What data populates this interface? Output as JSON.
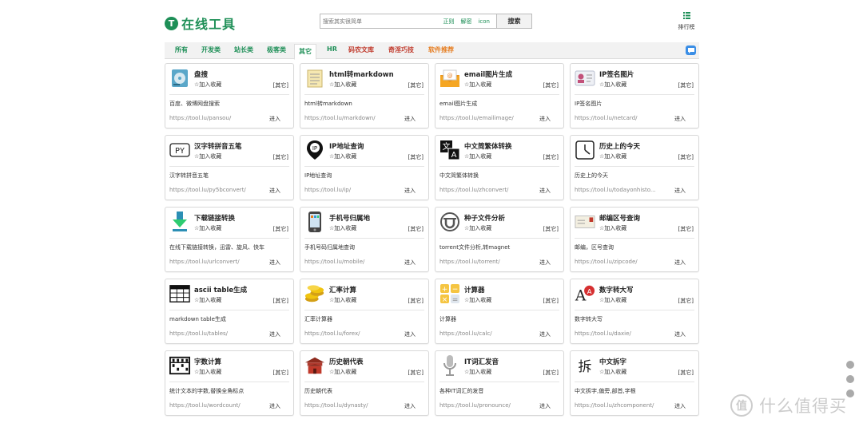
{
  "header": {
    "logo_letter": "T",
    "logo_text": "在线工具",
    "search_placeholder": "搜索其实很简单",
    "search_options": [
      "正则",
      "解密",
      "icon"
    ],
    "search_button": "搜索",
    "rank_label": "排行榜"
  },
  "tabs": [
    {
      "label": "所有",
      "style": "normal"
    },
    {
      "label": "开发类",
      "style": "normal"
    },
    {
      "label": "站长类",
      "style": "normal"
    },
    {
      "label": "极客类",
      "style": "normal"
    },
    {
      "label": "其它",
      "style": "active"
    },
    {
      "label": "HR",
      "style": "normal"
    },
    {
      "label": "码农文库",
      "style": "red"
    },
    {
      "label": "奇淫巧技",
      "style": "red"
    },
    {
      "label": "软件推荐",
      "style": "orange"
    }
  ],
  "colors": {
    "brand": "#1e8f57",
    "accent_red": "#c0392b",
    "accent_orange": "#e67e22"
  },
  "fav_label": "☆加入收藏",
  "category_label": "[其它]",
  "enter_label": "进入",
  "cards": [
    {
      "title": "盘搜",
      "icon": "disk-icon",
      "desc": "百度、微博网盘搜索",
      "url": "https://tool.lu/pansou/"
    },
    {
      "title": "html转markdown",
      "icon": "notepad-icon",
      "desc": "html转markdown",
      "url": "https://tool.lu/markdown/"
    },
    {
      "title": "email图片生成",
      "icon": "email-icon",
      "desc": "email图片生成",
      "url": "https://tool.lu/emailimage/"
    },
    {
      "title": "IP签名图片",
      "icon": "id-card-icon",
      "desc": "IP签名图片",
      "url": "https://tool.lu/netcard/"
    },
    {
      "title": "汉字转拼音五笔",
      "icon": "pinyin-icon",
      "desc": "汉字转拼音五笔",
      "url": "https://tool.lu/py5bconvert/"
    },
    {
      "title": "IP地址查询",
      "icon": "location-pin-icon",
      "desc": "IP地址查询",
      "url": "https://tool.lu/ip/"
    },
    {
      "title": "中文简繁体转换",
      "icon": "translate-icon",
      "desc": "中文简繁体转换",
      "url": "https://tool.lu/zhconvert/"
    },
    {
      "title": "历史上的今天",
      "icon": "clock-icon",
      "desc": "历史上的今天",
      "url": "https://tool.lu/todayonhisto..."
    },
    {
      "title": "下载链接转换",
      "icon": "download-icon",
      "desc": "在线下载链接转换，迅雷、旋风、快车",
      "url": "https://tool.lu/urlconvert/"
    },
    {
      "title": "手机号归属地",
      "icon": "phone-icon",
      "desc": "手机号码归属地查询",
      "url": "https://tool.lu/mobile/"
    },
    {
      "title": "种子文件分析",
      "icon": "torrent-icon",
      "desc": "torrent文件分析,转magnet",
      "url": "https://tool.lu/torrent/"
    },
    {
      "title": "邮编区号查询",
      "icon": "envelope-icon",
      "desc": "邮编，区号查询",
      "url": "https://tool.lu/zipcode/"
    },
    {
      "title": "ascii table生成",
      "icon": "table-icon",
      "desc": "markdown table生成",
      "url": "https://tool.lu/tables/"
    },
    {
      "title": "汇率计算",
      "icon": "coins-icon",
      "desc": "汇率计算器",
      "url": "https://tool.lu/forex/"
    },
    {
      "title": "计算器",
      "icon": "calculator-icon",
      "desc": "计算器",
      "url": "https://tool.lu/calc/"
    },
    {
      "title": "数字转大写",
      "icon": "font-icon",
      "desc": "数字转大写",
      "url": "https://tool.lu/daxie/"
    },
    {
      "title": "字数计算",
      "icon": "abacus-icon",
      "desc": "统计文本的字数,替换全角标点",
      "url": "https://tool.lu/wordcount/"
    },
    {
      "title": "历史朝代表",
      "icon": "palace-icon",
      "desc": "历史朝代表",
      "url": "https://tool.lu/dynasty/"
    },
    {
      "title": "IT词汇发音",
      "icon": "microphone-icon",
      "desc": "各种IT词汇的发音",
      "url": "https://tool.lu/pronounce/"
    },
    {
      "title": "中文拆字",
      "icon": "chai-character-icon",
      "desc": "中文拆字,偏旁,部首,字根",
      "url": "https://tool.lu/zhcomponent/"
    }
  ],
  "icon_glyphs": {
    "pinyin": "PY",
    "translate_a": "文",
    "translate_b": "A",
    "font_a": "A",
    "chai": "拆"
  },
  "watermark": {
    "symbol": "值",
    "text": "什么值得买"
  }
}
